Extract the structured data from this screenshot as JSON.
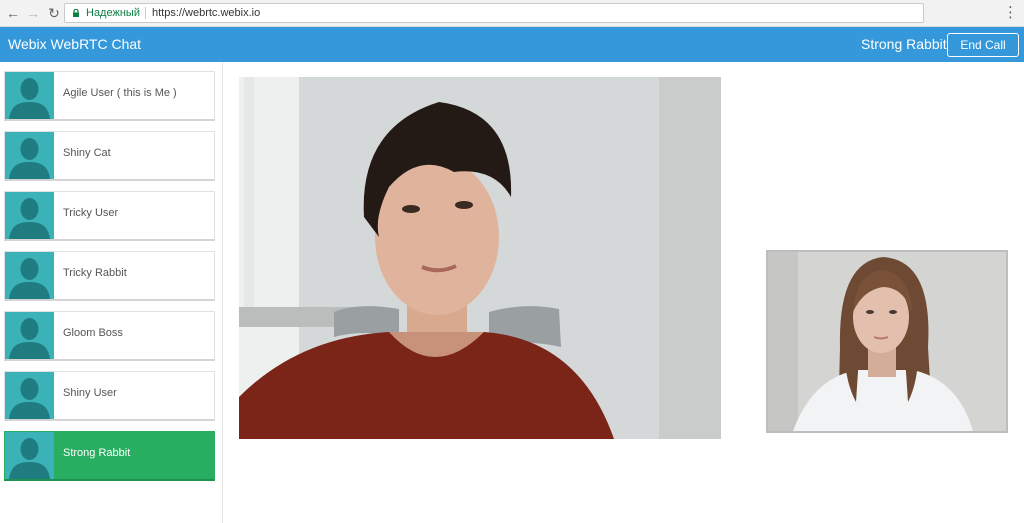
{
  "browser": {
    "secure_label": "Надежный",
    "url": "https://webrtc.webix.io",
    "icons": [
      "back-arrow-icon",
      "forward-arrow-icon",
      "reload-icon",
      "lock-icon",
      "menu-dots-icon"
    ]
  },
  "header": {
    "title": "Webix WebRTC Chat",
    "current_user": "Strong Rabbit",
    "end_call_label": "End Call",
    "color": "#3498db"
  },
  "users": [
    {
      "name": "Agile User ( this is Me )",
      "active": false
    },
    {
      "name": "Shiny Cat",
      "active": false
    },
    {
      "name": "Tricky User",
      "active": false
    },
    {
      "name": "Tricky Rabbit",
      "active": false
    },
    {
      "name": "Gloom Boss",
      "active": false
    },
    {
      "name": "Shiny User",
      "active": false
    },
    {
      "name": "Strong Rabbit",
      "active": true
    }
  ],
  "colors": {
    "active_user": "#27ae60",
    "avatar": "#3bb1b8"
  }
}
